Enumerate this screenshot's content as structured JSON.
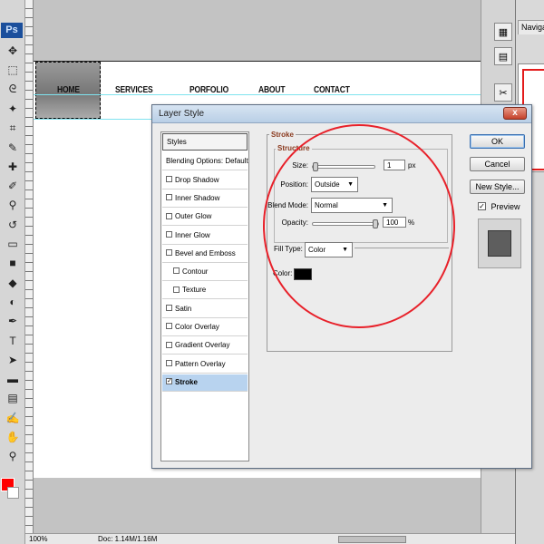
{
  "app": {
    "logo": "Ps",
    "accent_color": "#1b4f9c"
  },
  "tools": [
    {
      "name": "move-icon"
    },
    {
      "name": "marquee-icon"
    },
    {
      "name": "lasso-icon"
    },
    {
      "name": "magic-wand-icon"
    },
    {
      "name": "crop-icon"
    },
    {
      "name": "eyedropper-icon"
    },
    {
      "name": "healing-brush-icon"
    },
    {
      "name": "brush-icon"
    },
    {
      "name": "clone-stamp-icon"
    },
    {
      "name": "history-brush-icon"
    },
    {
      "name": "eraser-icon"
    },
    {
      "name": "gradient-icon"
    },
    {
      "name": "blur-icon"
    },
    {
      "name": "dodge-icon"
    },
    {
      "name": "pen-icon"
    },
    {
      "name": "type-icon"
    },
    {
      "name": "path-select-icon"
    },
    {
      "name": "shape-icon"
    },
    {
      "name": "notes-icon"
    },
    {
      "name": "eyedropper2-icon"
    },
    {
      "name": "hand-icon"
    },
    {
      "name": "zoom-icon"
    }
  ],
  "colors": {
    "foreground": "#ff0000",
    "background": "#ffffff"
  },
  "canvas": {
    "nav_items": [
      "HOME",
      "SERVICES",
      "PORFOLIO",
      "ABOUT",
      "CONTACT"
    ]
  },
  "status": {
    "zoom": "100%",
    "doc": "Doc: 1.14M/1.16M"
  },
  "right_panel": {
    "navigator_tab": "Navigat"
  },
  "dialog": {
    "title": "Layer Style",
    "close_label": "x",
    "styles_list": [
      {
        "label": "Styles",
        "type": "head"
      },
      {
        "label": "Blending Options: Default",
        "type": "plain"
      },
      {
        "label": "Drop Shadow",
        "type": "check",
        "checked": false
      },
      {
        "label": "Inner Shadow",
        "type": "check",
        "checked": false
      },
      {
        "label": "Outer Glow",
        "type": "check",
        "checked": false
      },
      {
        "label": "Inner Glow",
        "type": "check",
        "checked": false
      },
      {
        "label": "Bevel and Emboss",
        "type": "check",
        "checked": false
      },
      {
        "label": "Contour",
        "type": "subcheck",
        "checked": false
      },
      {
        "label": "Texture",
        "type": "subcheck",
        "checked": false
      },
      {
        "label": "Satin",
        "type": "check",
        "checked": false
      },
      {
        "label": "Color Overlay",
        "type": "check",
        "checked": false
      },
      {
        "label": "Gradient Overlay",
        "type": "check",
        "checked": false
      },
      {
        "label": "Pattern Overlay",
        "type": "check",
        "checked": false
      },
      {
        "label": "Stroke",
        "type": "check",
        "checked": true,
        "selected": true
      }
    ],
    "stroke": {
      "group_label": "Stroke",
      "structure_label": "Structure",
      "size_label": "Size:",
      "size_value": "1",
      "size_unit": "px",
      "position_label": "Position:",
      "position_value": "Outside",
      "blend_mode_label": "Blend Mode:",
      "blend_mode_value": "Normal",
      "opacity_label": "Opacity:",
      "opacity_value": "100",
      "opacity_unit": "%",
      "opacity_level": 1.0,
      "size_level": 0.0,
      "fill_type_label": "Fill Type:",
      "fill_type_value": "Color",
      "color_label": "Color:",
      "stroke_color": "#000000"
    },
    "buttons": {
      "ok": "OK",
      "cancel": "Cancel",
      "new_style": "New Style..."
    },
    "preview": {
      "label": "Preview",
      "checked": true,
      "check_glyph": "✓"
    }
  },
  "annotation": {
    "circle_color": "#e8212a"
  }
}
